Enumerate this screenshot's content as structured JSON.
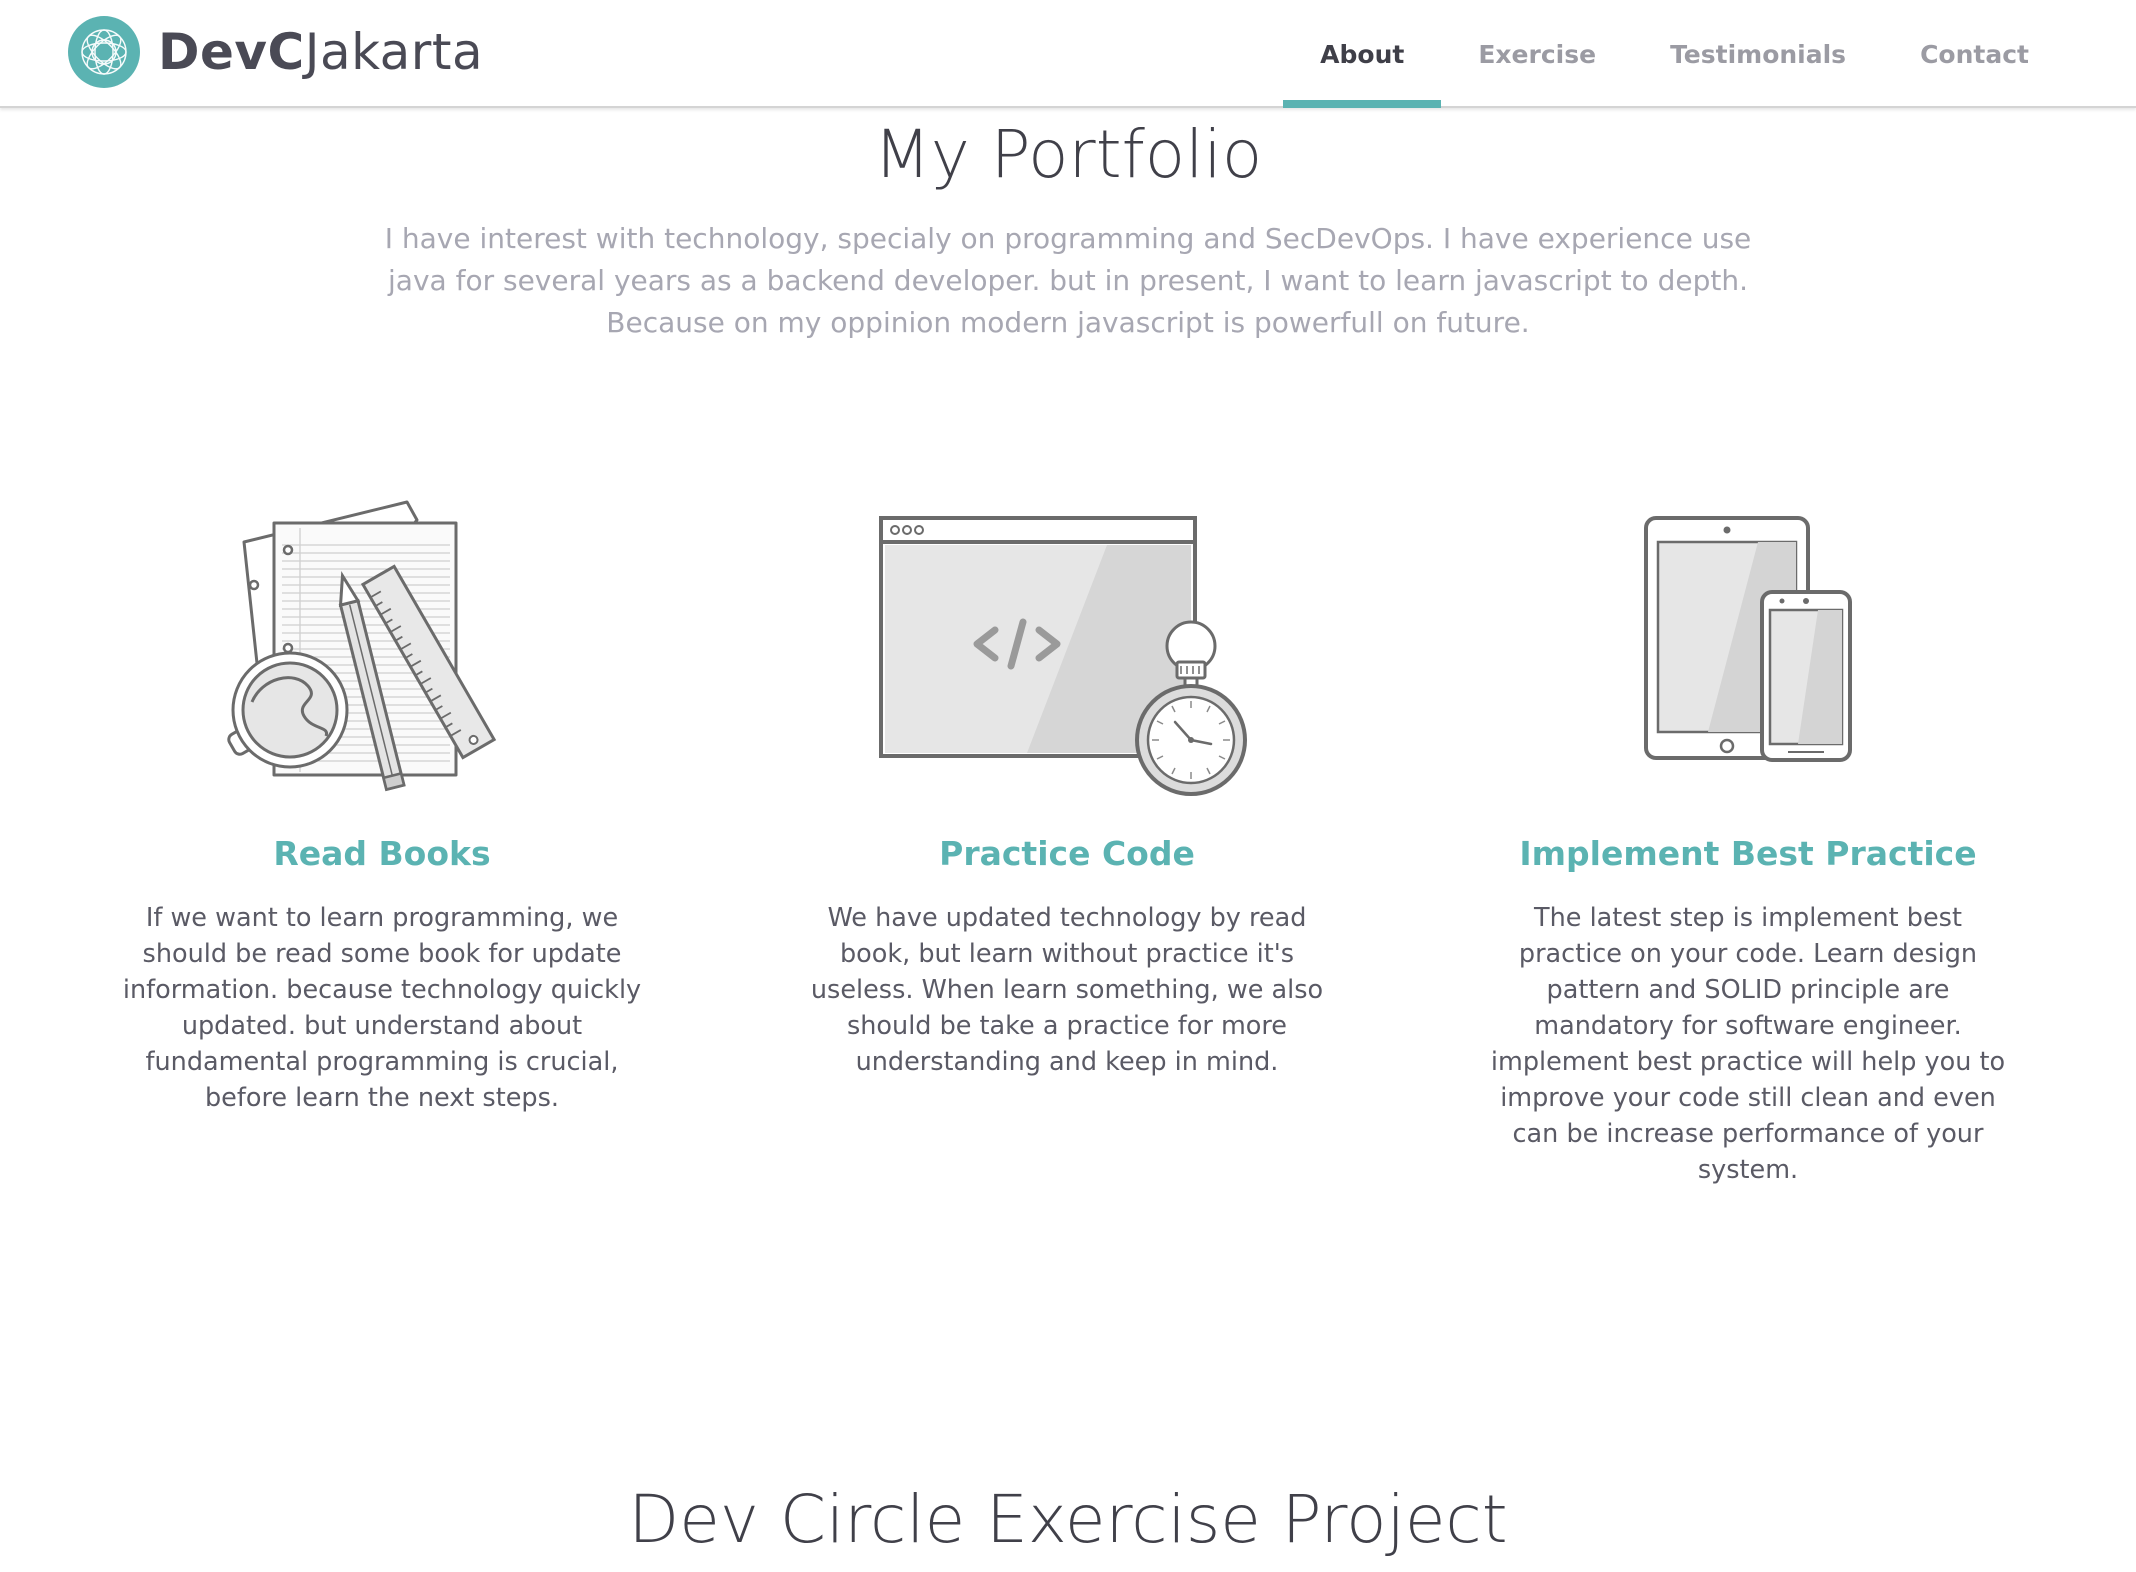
{
  "nav": {
    "brand_bold": "DevC",
    "brand_light": "Jakarta",
    "links": [
      {
        "label": "About",
        "active": true
      },
      {
        "label": "Exercise",
        "active": false
      },
      {
        "label": "Testimonials",
        "active": false
      },
      {
        "label": "Contact",
        "active": false
      }
    ]
  },
  "portfolio": {
    "title": "My Portfolio",
    "intro": "I have interest with technology, specialy on programming and SecDevOps. I have experience use java for several years as a backend developer. but in present, I want to learn javascript to depth. Because on my oppinion modern javascript is powerfull on future."
  },
  "features": [
    {
      "icon": "books-icon",
      "title": "Read Books",
      "description": "If we want to learn programming, we should be read some book for update information. because technology quickly updated. but understand about fundamental programming is crucial, before learn the next steps."
    },
    {
      "icon": "code-browser-icon",
      "title": "Practice Code",
      "description": "We have updated technology by read book, but learn without practice it's useless. When learn something, we also should be take a practice for more understanding and keep in mind."
    },
    {
      "icon": "devices-icon",
      "title": "Implement Best Practice",
      "description": "The latest step is implement best practice on your code. Learn design pattern and SOLID principle are mandatory for software engineer. implement best practice will help you to improve your code still clean and even can be increase performance of your system."
    }
  ],
  "exercise": {
    "title": "Dev Circle Exercise Project"
  },
  "colors": {
    "accent": "#5bb3b2",
    "heading": "#404049",
    "muted": "#a7a7b2",
    "nav_inactive": "#9b9ba3"
  }
}
